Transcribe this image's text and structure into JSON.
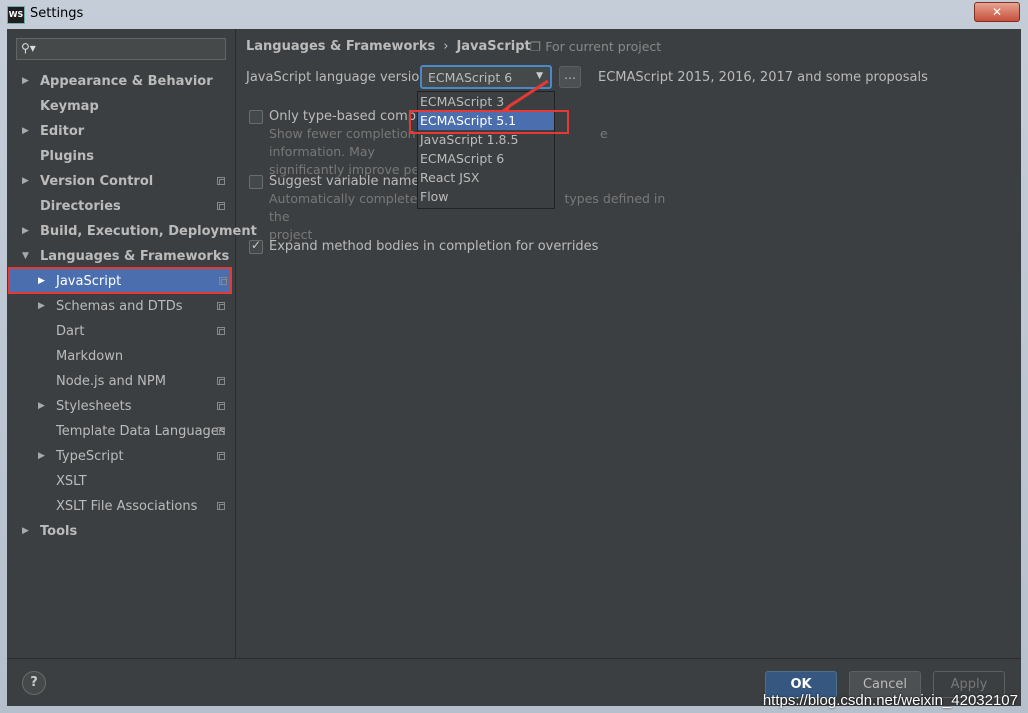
{
  "window": {
    "title": "Settings",
    "app_icon": "WS",
    "close": "✕"
  },
  "search": {
    "placeholder": ""
  },
  "sidebar": {
    "items": [
      {
        "label": "Appearance & Behavior",
        "arrow": "▶"
      },
      {
        "label": "Keymap"
      },
      {
        "label": "Editor",
        "arrow": "▶"
      },
      {
        "label": "Plugins"
      },
      {
        "label": "Version Control",
        "arrow": "▶"
      },
      {
        "label": "Directories"
      },
      {
        "label": "Build, Execution, Deployment",
        "arrow": "▶"
      },
      {
        "label": "Languages & Frameworks",
        "arrow": "▼"
      },
      {
        "label": "JavaScript",
        "arrow": "▶"
      },
      {
        "label": "Schemas and DTDs",
        "arrow": "▶"
      },
      {
        "label": "Dart"
      },
      {
        "label": "Markdown"
      },
      {
        "label": "Node.js and NPM"
      },
      {
        "label": "Stylesheets",
        "arrow": "▶"
      },
      {
        "label": "Template Data Languages"
      },
      {
        "label": "TypeScript",
        "arrow": "▶"
      },
      {
        "label": "XSLT"
      },
      {
        "label": "XSLT File Associations"
      },
      {
        "label": "Tools",
        "arrow": "▶"
      }
    ]
  },
  "breadcrumb": {
    "parent": "Languages & Frameworks",
    "separator": "›",
    "current": "JavaScript"
  },
  "scope": {
    "label": "For current project"
  },
  "language_version": {
    "label": "JavaScript language version",
    "value": "ECMAScript 6",
    "more": "...",
    "description": "ECMAScript 2015, 2016, 2017 and some proposals"
  },
  "dropdown": {
    "options": [
      "ECMAScript 3",
      "ECMAScript 5.1",
      "JavaScript 1.8.5",
      "ECMAScript 6",
      "React JSX",
      "Flow"
    ],
    "highlighted": "ECMAScript 5.1"
  },
  "options": {
    "type_based": {
      "label": "Only type-based completi",
      "desc_a": "Show fewer completion s",
      "desc_b": "e information. May",
      "desc_c": "significantly improve perf",
      "checked": false
    },
    "suggest_names": {
      "label": "Suggest variable names",
      "desc_a": "Automatically complete va",
      "desc_b": "types defined in the",
      "desc_c": "project",
      "checked": false
    },
    "expand_bodies": {
      "label": "Expand method bodies in completion for overrides",
      "checked": true,
      "mark": "✓"
    }
  },
  "footer": {
    "help": "?",
    "ok": "OK",
    "cancel": "Cancel",
    "apply": "Apply"
  },
  "watermark": "https://blog.csdn.net/weixin_42032107",
  "colors": {
    "selection": "#4b6eaf",
    "highlight": "#e53935",
    "background": "#3c3f41"
  }
}
